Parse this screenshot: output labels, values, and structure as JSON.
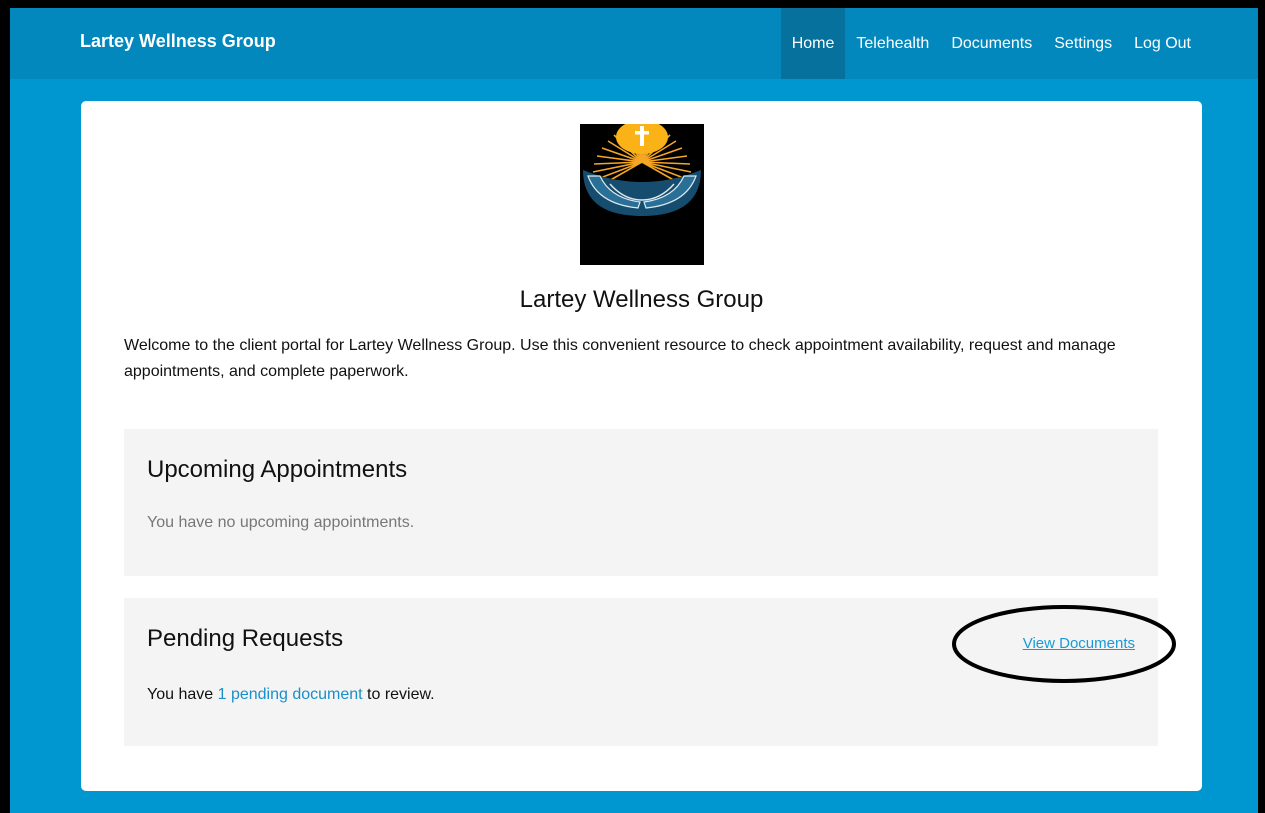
{
  "navbar": {
    "brand": "Lartey Wellness Group",
    "items": [
      {
        "label": "Home",
        "active": true
      },
      {
        "label": "Telehealth",
        "active": false
      },
      {
        "label": "Documents",
        "active": false
      },
      {
        "label": "Settings",
        "active": false
      },
      {
        "label": "Log Out",
        "active": false
      }
    ]
  },
  "header": {
    "logo_icon": "praying-hands-cross-sun-logo",
    "title": "Lartey Wellness Group",
    "welcome": "Welcome to the client portal for Lartey Wellness Group. Use this convenient resource to check appointment availability, request and manage appointments, and complete paperwork."
  },
  "appointments": {
    "title": "Upcoming Appointments",
    "empty_message": "You have no upcoming appointments."
  },
  "pending": {
    "title": "Pending Requests",
    "text_before": "You have ",
    "link_text": "1 pending document",
    "text_after": " to review.",
    "view_link": "View Documents"
  },
  "colors": {
    "page_bg": "#0097d1",
    "navbar_bg": "#0288bd",
    "nav_active": "#05719c",
    "link": "#1a8fc9",
    "panel_bg": "#f4f4f4"
  }
}
